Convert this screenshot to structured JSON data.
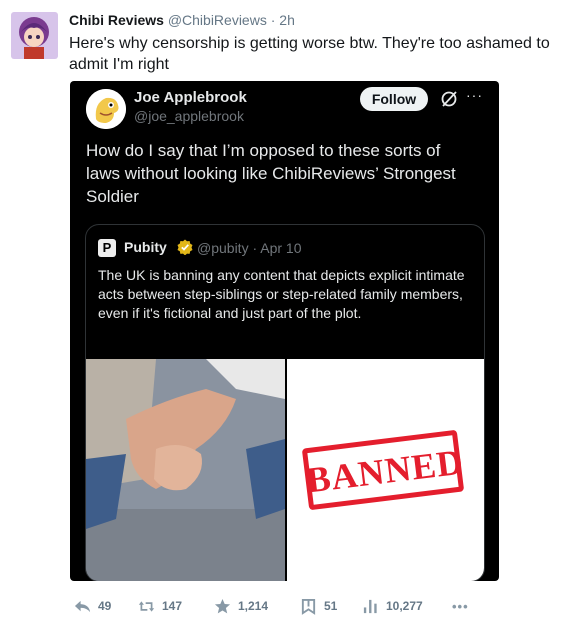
{
  "tweet": {
    "author_name": "Chibi Reviews",
    "author_handle": "@ChibiReviews",
    "time": "· 2h",
    "text": "Here's why censorship is getting worse btw. They're too ashamed to admit I'm right"
  },
  "quote": {
    "author_name": "Joe Applebrook",
    "author_handle": "@joe_applebrook",
    "follow_label": "Follow",
    "more_label": "···",
    "text": "How do I say that I’m opposed to these sorts of laws without looking like ChibiReviews’ Strongest Soldier"
  },
  "nested": {
    "avatar_letter": "P",
    "author_name": "Pubity",
    "meta": "@pubity · Apr 10",
    "text": "The UK is banning any content that depicts explicit intimate acts between step-siblings or step-related family members, even if it's fictional and just part of the plot.",
    "stamp_text": "BANNED"
  },
  "actions": {
    "replies": "49",
    "retweets": "147",
    "likes": "1,214",
    "bookmarks": "51",
    "views": "10,277",
    "more": "•••"
  },
  "colors": {
    "brand_red": "#e41e2d",
    "verified_gold": "#e2b719",
    "muted": "#657786"
  }
}
